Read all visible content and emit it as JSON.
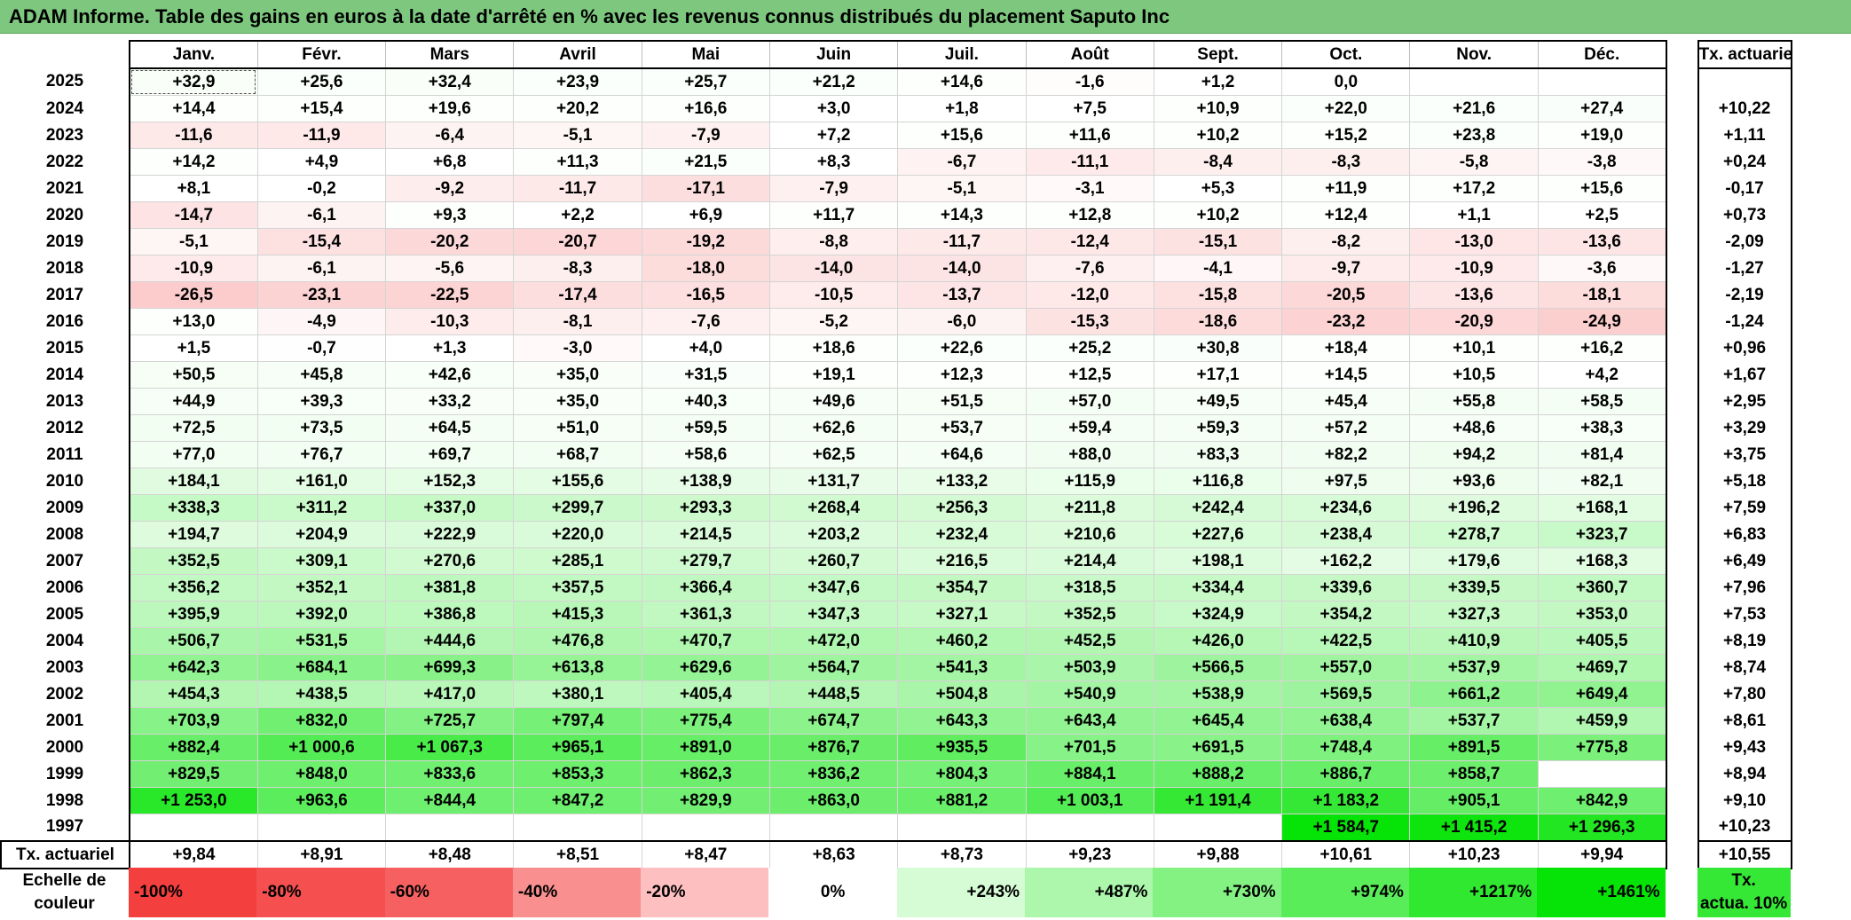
{
  "title": "ADAM Informe. Table des gains en euros à la date d'arrêté en % avec les revenus connus distribués du placement Saputo Inc",
  "header": {
    "months": [
      "Janv.",
      "Févr.",
      "Mars",
      "Avril",
      "Mai",
      "Juin",
      "Juil.",
      "Août",
      "Sept.",
      "Oct.",
      "Nov.",
      "Déc."
    ],
    "tx_label": "Tx. actuariel"
  },
  "rows": [
    {
      "year": "2025",
      "cells": [
        "+32,9",
        "+25,6",
        "+32,4",
        "+23,9",
        "+25,7",
        "+21,2",
        "+14,6",
        "-1,6",
        "+1,2",
        "0,0",
        "",
        ""
      ],
      "tx": ""
    },
    {
      "year": "2024",
      "cells": [
        "+14,4",
        "+15,4",
        "+19,6",
        "+20,2",
        "+16,6",
        "+3,0",
        "+1,8",
        "+7,5",
        "+10,9",
        "+22,0",
        "+21,6",
        "+27,4"
      ],
      "tx": "+10,22"
    },
    {
      "year": "2023",
      "cells": [
        "-11,6",
        "-11,9",
        "-6,4",
        "-5,1",
        "-7,9",
        "+7,2",
        "+15,6",
        "+11,6",
        "+10,2",
        "+15,2",
        "+23,8",
        "+19,0"
      ],
      "tx": "+1,11"
    },
    {
      "year": "2022",
      "cells": [
        "+14,2",
        "+4,9",
        "+6,8",
        "+11,3",
        "+21,5",
        "+8,3",
        "-6,7",
        "-11,1",
        "-8,4",
        "-8,3",
        "-5,8",
        "-3,8"
      ],
      "tx": "+0,24"
    },
    {
      "year": "2021",
      "cells": [
        "+8,1",
        "-0,2",
        "-9,2",
        "-11,7",
        "-17,1",
        "-7,9",
        "-5,1",
        "-3,1",
        "+5,3",
        "+11,9",
        "+17,2",
        "+15,6"
      ],
      "tx": "-0,17"
    },
    {
      "year": "2020",
      "cells": [
        "-14,7",
        "-6,1",
        "+9,3",
        "+2,2",
        "+6,9",
        "+11,7",
        "+14,3",
        "+12,8",
        "+10,2",
        "+12,4",
        "+1,1",
        "+2,5"
      ],
      "tx": "+0,73"
    },
    {
      "year": "2019",
      "cells": [
        "-5,1",
        "-15,4",
        "-20,2",
        "-20,7",
        "-19,2",
        "-8,8",
        "-11,7",
        "-12,4",
        "-15,1",
        "-8,2",
        "-13,0",
        "-13,6"
      ],
      "tx": "-2,09"
    },
    {
      "year": "2018",
      "cells": [
        "-10,9",
        "-6,1",
        "-5,6",
        "-8,3",
        "-18,0",
        "-14,0",
        "-14,0",
        "-7,6",
        "-4,1",
        "-9,7",
        "-10,9",
        "-3,6"
      ],
      "tx": "-1,27"
    },
    {
      "year": "2017",
      "cells": [
        "-26,5",
        "-23,1",
        "-22,5",
        "-17,4",
        "-16,5",
        "-10,5",
        "-13,7",
        "-12,0",
        "-15,8",
        "-20,5",
        "-13,6",
        "-18,1"
      ],
      "tx": "-2,19"
    },
    {
      "year": "2016",
      "cells": [
        "+13,0",
        "-4,9",
        "-10,3",
        "-8,1",
        "-7,6",
        "-5,2",
        "-6,0",
        "-15,3",
        "-18,6",
        "-23,2",
        "-20,9",
        "-24,9"
      ],
      "tx": "-1,24"
    },
    {
      "year": "2015",
      "cells": [
        "+1,5",
        "-0,7",
        "+1,3",
        "-3,0",
        "+4,0",
        "+18,6",
        "+22,6",
        "+25,2",
        "+30,8",
        "+18,4",
        "+10,1",
        "+16,2"
      ],
      "tx": "+0,96"
    },
    {
      "year": "2014",
      "cells": [
        "+50,5",
        "+45,8",
        "+42,6",
        "+35,0",
        "+31,5",
        "+19,1",
        "+12,3",
        "+12,5",
        "+17,1",
        "+14,5",
        "+10,5",
        "+4,2"
      ],
      "tx": "+1,67"
    },
    {
      "year": "2013",
      "cells": [
        "+44,9",
        "+39,3",
        "+33,2",
        "+35,0",
        "+40,3",
        "+49,6",
        "+51,5",
        "+57,0",
        "+49,5",
        "+45,4",
        "+55,8",
        "+58,5"
      ],
      "tx": "+2,95"
    },
    {
      "year": "2012",
      "cells": [
        "+72,5",
        "+73,5",
        "+64,5",
        "+51,0",
        "+59,5",
        "+62,6",
        "+53,7",
        "+59,4",
        "+59,3",
        "+57,2",
        "+48,6",
        "+38,3"
      ],
      "tx": "+3,29"
    },
    {
      "year": "2011",
      "cells": [
        "+77,0",
        "+76,7",
        "+69,7",
        "+68,7",
        "+58,6",
        "+62,5",
        "+64,6",
        "+88,0",
        "+83,3",
        "+82,2",
        "+94,2",
        "+81,4"
      ],
      "tx": "+3,75"
    },
    {
      "year": "2010",
      "cells": [
        "+184,1",
        "+161,0",
        "+152,3",
        "+155,6",
        "+138,9",
        "+131,7",
        "+133,2",
        "+115,9",
        "+116,8",
        "+97,5",
        "+93,6",
        "+82,1"
      ],
      "tx": "+5,18"
    },
    {
      "year": "2009",
      "cells": [
        "+338,3",
        "+311,2",
        "+337,0",
        "+299,7",
        "+293,3",
        "+268,4",
        "+256,3",
        "+211,8",
        "+242,4",
        "+234,6",
        "+196,2",
        "+168,1"
      ],
      "tx": "+7,59"
    },
    {
      "year": "2008",
      "cells": [
        "+194,7",
        "+204,9",
        "+222,9",
        "+220,0",
        "+214,5",
        "+203,2",
        "+232,4",
        "+210,6",
        "+227,6",
        "+238,4",
        "+278,7",
        "+323,7"
      ],
      "tx": "+6,83"
    },
    {
      "year": "2007",
      "cells": [
        "+352,5",
        "+309,1",
        "+270,6",
        "+285,1",
        "+279,7",
        "+260,7",
        "+216,5",
        "+214,4",
        "+198,1",
        "+162,2",
        "+179,6",
        "+168,3"
      ],
      "tx": "+6,49"
    },
    {
      "year": "2006",
      "cells": [
        "+356,2",
        "+352,1",
        "+381,8",
        "+357,5",
        "+366,4",
        "+347,6",
        "+354,7",
        "+318,5",
        "+334,4",
        "+339,6",
        "+339,5",
        "+360,7"
      ],
      "tx": "+7,96"
    },
    {
      "year": "2005",
      "cells": [
        "+395,9",
        "+392,0",
        "+386,8",
        "+415,3",
        "+361,3",
        "+347,3",
        "+327,1",
        "+352,5",
        "+324,9",
        "+354,2",
        "+327,3",
        "+353,0"
      ],
      "tx": "+7,53"
    },
    {
      "year": "2004",
      "cells": [
        "+506,7",
        "+531,5",
        "+444,6",
        "+476,8",
        "+470,7",
        "+472,0",
        "+460,2",
        "+452,5",
        "+426,0",
        "+422,5",
        "+410,9",
        "+405,5"
      ],
      "tx": "+8,19"
    },
    {
      "year": "2003",
      "cells": [
        "+642,3",
        "+684,1",
        "+699,3",
        "+613,8",
        "+629,6",
        "+564,7",
        "+541,3",
        "+503,9",
        "+566,5",
        "+557,0",
        "+537,9",
        "+469,7"
      ],
      "tx": "+8,74"
    },
    {
      "year": "2002",
      "cells": [
        "+454,3",
        "+438,5",
        "+417,0",
        "+380,1",
        "+405,4",
        "+448,5",
        "+504,8",
        "+540,9",
        "+538,9",
        "+569,5",
        "+661,2",
        "+649,4"
      ],
      "tx": "+7,80"
    },
    {
      "year": "2001",
      "cells": [
        "+703,9",
        "+832,0",
        "+725,7",
        "+797,4",
        "+775,4",
        "+674,7",
        "+643,3",
        "+643,4",
        "+645,4",
        "+638,4",
        "+537,7",
        "+459,9"
      ],
      "tx": "+8,61"
    },
    {
      "year": "2000",
      "cells": [
        "+882,4",
        "+1 000,6",
        "+1 067,3",
        "+965,1",
        "+891,0",
        "+876,7",
        "+935,5",
        "+701,5",
        "+691,5",
        "+748,4",
        "+891,5",
        "+775,8"
      ],
      "tx": "+9,43"
    },
    {
      "year": "1999",
      "cells": [
        "+829,5",
        "+848,0",
        "+833,6",
        "+853,3",
        "+862,3",
        "+836,2",
        "+804,3",
        "+884,1",
        "+888,2",
        "+886,7",
        "+858,7"
      ],
      "tx": "+8,94",
      "offset": 1
    },
    {
      "year": "1998",
      "cells": [
        "+1 253,0",
        "+963,6",
        "+844,4",
        "+847,2",
        "+829,9",
        "+863,0",
        "+881,2",
        "+1 003,1",
        "+1 191,4",
        "+1 183,2",
        "+905,1",
        "+842,9"
      ],
      "tx": "+9,10"
    },
    {
      "year": "1997",
      "cells": [
        "",
        "",
        "",
        "",
        "",
        "",
        "",
        "",
        "",
        "+1 584,7",
        "+1 415,2",
        "+1 296,3"
      ],
      "tx": "+10,23"
    }
  ],
  "summary": {
    "label": "Tx. actuariel",
    "cells": [
      "+9,84",
      "+8,91",
      "+8,48",
      "+8,51",
      "+8,47",
      "+8,63",
      "+8,73",
      "+9,23",
      "+9,88",
      "+10,61",
      "+10,23",
      "+9,94"
    ],
    "tx": "+10,55"
  },
  "scale": {
    "label_line1": "Echelle de",
    "label_line2": "couleur",
    "items": [
      {
        "text": "-100%",
        "color": "#f43f3f",
        "align": "left"
      },
      {
        "text": "-80%",
        "color": "#f54f4f",
        "align": "left"
      },
      {
        "text": "-60%",
        "color": "#f76060",
        "align": "left"
      },
      {
        "text": "-40%",
        "color": "#fa8f8f",
        "align": "left"
      },
      {
        "text": "-20%",
        "color": "#fdbfbf",
        "align": "left"
      },
      {
        "text": "0%",
        "color": "#ffffff",
        "align": "center"
      },
      {
        "text": "+243%",
        "color": "#d6fcd6",
        "align": "right"
      },
      {
        "text": "+487%",
        "color": "#acf7ac",
        "align": "right"
      },
      {
        "text": "+730%",
        "color": "#83f283",
        "align": "right"
      },
      {
        "text": "+974%",
        "color": "#59ed59",
        "align": "right"
      },
      {
        "text": "+1217%",
        "color": "#30e830",
        "align": "right"
      },
      {
        "text": "+1461%",
        "color": "#06e306",
        "align": "right"
      }
    ],
    "tx_line1": "Tx.",
    "tx_line2": "actua. 10%",
    "tx_color": "#36e836"
  }
}
